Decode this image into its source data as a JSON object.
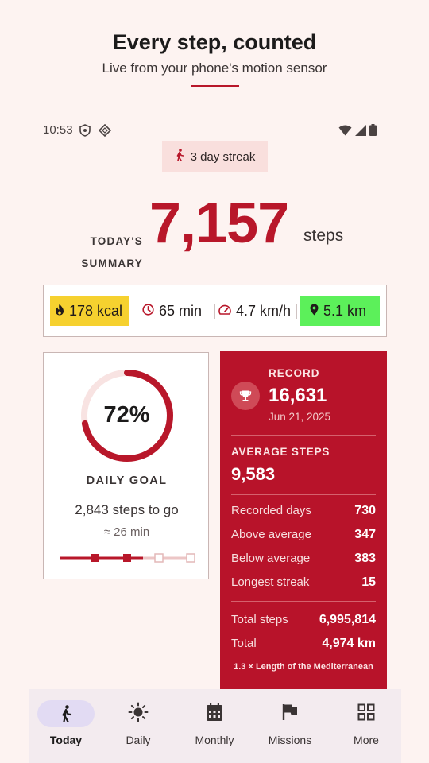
{
  "promo": {
    "headline": "Every step, counted",
    "subhead": "Live from your phone's motion sensor"
  },
  "status_bar": {
    "time": "10:53",
    "icons": [
      "shield-icon",
      "diamond-icon",
      "wifi-icon",
      "signal-icon",
      "battery-icon"
    ]
  },
  "streak": {
    "label": "3 day streak",
    "icon": "walk-icon"
  },
  "summary": {
    "label_line1": "TODAY'S",
    "label_line2": "SUMMARY",
    "steps": "7,157",
    "unit": "steps"
  },
  "metrics": {
    "kcal": "178 kcal",
    "duration": "65 min",
    "speed": "4.7 km/h",
    "distance": "5.1 km",
    "colors": {
      "kcal": "#f6d12f",
      "distance": "#5cf05a"
    }
  },
  "goal": {
    "percent_label": "72%",
    "percent": 0.72,
    "label": "DAILY GOAL",
    "steps_to_go": "2,843 steps to go",
    "time_to_go": "≈ 26 min",
    "milestones_reached": 2,
    "milestones_total": 4
  },
  "record": {
    "label": "RECORD",
    "value": "16,631",
    "date": "Jun 21, 2025",
    "icon": "trophy-icon"
  },
  "average": {
    "label": "AVERAGE STEPS",
    "value": "9,583",
    "rows": [
      {
        "label": "Recorded days",
        "value": "730"
      },
      {
        "label": "Above average",
        "value": "347"
      },
      {
        "label": "Below average",
        "value": "383"
      },
      {
        "label": "Longest streak",
        "value": "15"
      }
    ]
  },
  "totals": {
    "rows": [
      {
        "label": "Total steps",
        "value": "6,995,814"
      },
      {
        "label": "Total",
        "value": "4,974 km"
      }
    ],
    "comparison": "1.3 × Length of the Mediterranean"
  },
  "nav": {
    "items": [
      {
        "label": "Today",
        "icon": "walk-icon",
        "active": true
      },
      {
        "label": "Daily",
        "icon": "sun-icon",
        "active": false
      },
      {
        "label": "Monthly",
        "icon": "calendar-icon",
        "active": false
      },
      {
        "label": "Missions",
        "icon": "flag-icon",
        "active": false
      },
      {
        "label": "More",
        "icon": "grid-icon",
        "active": false
      }
    ]
  },
  "colors": {
    "accent": "#b8172a",
    "background": "#fdf3f1",
    "nav_background": "#f3ebef"
  }
}
